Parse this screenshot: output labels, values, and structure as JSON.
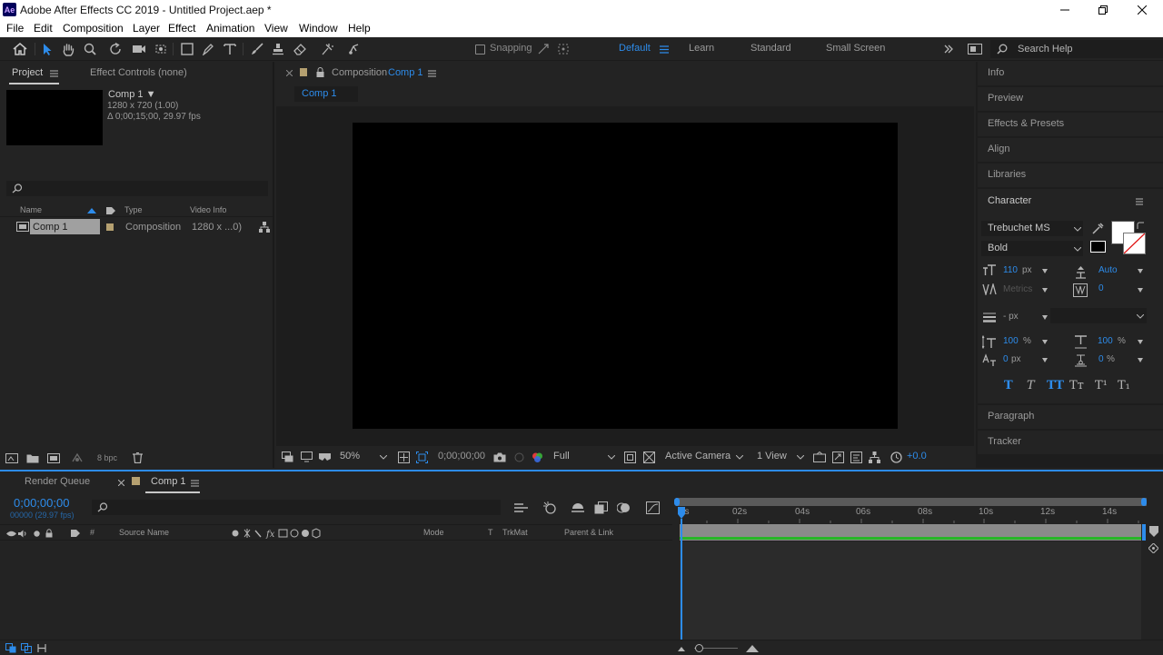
{
  "app": {
    "title": "Adobe After Effects CC 2019 - Untitled Project.aep *",
    "logo_text": "Ae"
  },
  "menu": [
    "File",
    "Edit",
    "Composition",
    "Layer",
    "Effect",
    "Animation",
    "View",
    "Window",
    "Help"
  ],
  "toolbar": {
    "snapping_label": "Snapping",
    "workspaces": [
      "Default",
      "Learn",
      "Standard",
      "Small Screen"
    ],
    "search_placeholder": "Search Help"
  },
  "project_panel": {
    "tabs": [
      "Project",
      "Effect Controls (none)"
    ],
    "preview": {
      "name": "Comp 1 ▼",
      "size": "1280 x 720 (1.00)",
      "duration": "Δ 0;00;15;00, 29.97 fps"
    },
    "search_placeholder": "",
    "columns": [
      "Name",
      "Type",
      "Video Info"
    ],
    "items": [
      {
        "name": "Comp 1",
        "type": "Composition",
        "info": "1280 x ...0)"
      }
    ],
    "bpc": "8 bpc"
  },
  "comp_panel": {
    "tab_prefix": "Composition",
    "tab_name": "Comp 1",
    "breadcrumb": "Comp 1",
    "zoom": "50%",
    "timecode": "0;00;00;00",
    "resolution": "Full",
    "camera": "Active Camera",
    "views": "1 View",
    "exposure": "+0.0"
  },
  "right_panels": {
    "items": [
      "Info",
      "Preview",
      "Effects & Presets",
      "Align",
      "Libraries"
    ],
    "character": {
      "title": "Character",
      "font": "Trebuchet MS",
      "style": "Bold",
      "size": "110",
      "size_unit": "px",
      "leading": "Auto",
      "kerning": "Metrics",
      "tracking": "0",
      "stroke": "- px",
      "vscale": "100",
      "hscale": "100",
      "baseline": "0",
      "baseline_unit": "px",
      "tsume": "0",
      "pct": "%",
      "style_buttons": [
        "T",
        "T",
        "TT",
        "Tт",
        "T¹",
        "T₁"
      ]
    },
    "bottom": [
      "Paragraph",
      "Tracker"
    ]
  },
  "timeline": {
    "tabs": [
      "Render Queue",
      "Comp 1"
    ],
    "timecode": "0;00;00;00",
    "frames": "00000 (29.97 fps)",
    "columns": [
      "#",
      "Source Name",
      "Mode",
      "T",
      "TrkMat",
      "Parent & Link"
    ],
    "ruler": [
      "0s",
      "02s",
      "04s",
      "06s",
      "08s",
      "10s",
      "12s",
      "14s"
    ]
  },
  "colors": {
    "accent": "#2d8ceb",
    "green_bar": "#27b627",
    "comp_label": "#b5a070"
  }
}
